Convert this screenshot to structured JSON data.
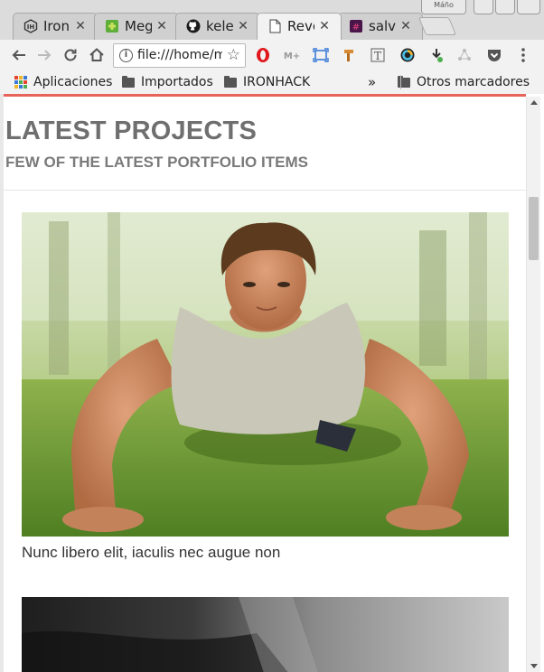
{
  "browser": {
    "tabs": [
      {
        "title": "IronHack",
        "icon": "ironhack-icon",
        "active": false
      },
      {
        "title": "Mega",
        "icon": "puzzle-icon",
        "active": false
      },
      {
        "title": "kelet",
        "icon": "github-icon",
        "active": false
      },
      {
        "title": "Revel",
        "icon": "document-icon",
        "active": true
      },
      {
        "title": "salva",
        "icon": "slack-icon",
        "active": false
      }
    ],
    "close_glyph": "✕",
    "window_label": "Máño",
    "url": "file:///home/m",
    "bookmarks": [
      {
        "label": "Aplicaciones",
        "icon": "apps-grid-icon"
      },
      {
        "label": "Importados",
        "icon": "folder-icon"
      },
      {
        "label": "IRONHACK",
        "icon": "folder-icon"
      }
    ],
    "more_bookmarks_glyph": "»",
    "other_bookmarks": "Otros marcadores",
    "colors": {
      "accent_line": "#e8635a"
    }
  },
  "page": {
    "title": "LATEST PROJECTS",
    "subtitle": "FEW OF THE LATEST PORTFOLIO ITEMS",
    "projects": [
      {
        "caption": "Nunc libero elit, iaculis nec augue non"
      }
    ]
  }
}
